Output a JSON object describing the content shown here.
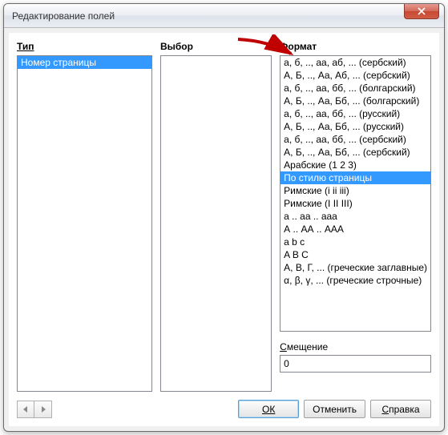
{
  "window": {
    "title": "Редактирование полей"
  },
  "labels": {
    "type": "Тип",
    "select": "Выбор",
    "format": "Формат",
    "offset": "Смещение"
  },
  "type_list": {
    "items": [
      "Номер страницы"
    ],
    "selected_index": 0
  },
  "select_list": {
    "items": []
  },
  "format_list": {
    "items": [
      "а, б, .., аа, аб, ... (сербский)",
      "А, Б, .., Аа, Аб, ... (сербский)",
      "а, б, .., аа, бб, ... (болгарский)",
      "А, Б, .., Аа, Бб, ... (болгарский)",
      "а, б, .., аа, бб, ... (русский)",
      "А, Б, .., Аа, Бб, ... (русский)",
      "а, б, .., аа, бб, ... (сербский)",
      "А, Б, .., Аа, Бб, ... (сербский)",
      "Арабские (1 2 3)",
      "По стилю страницы",
      "Римские (i ii iii)",
      "Римские (I II III)",
      "а .. аа .. ааа",
      "А .. АА .. ААА",
      "a b c",
      "A B C",
      "А, В, Г, ... (греческие заглавные)",
      "α, β, γ, ... (греческие строчные)"
    ],
    "selected_index": 9
  },
  "offset": {
    "value": "0"
  },
  "buttons": {
    "ok": "ОК",
    "cancel": "Отменить",
    "help": "Справка"
  }
}
